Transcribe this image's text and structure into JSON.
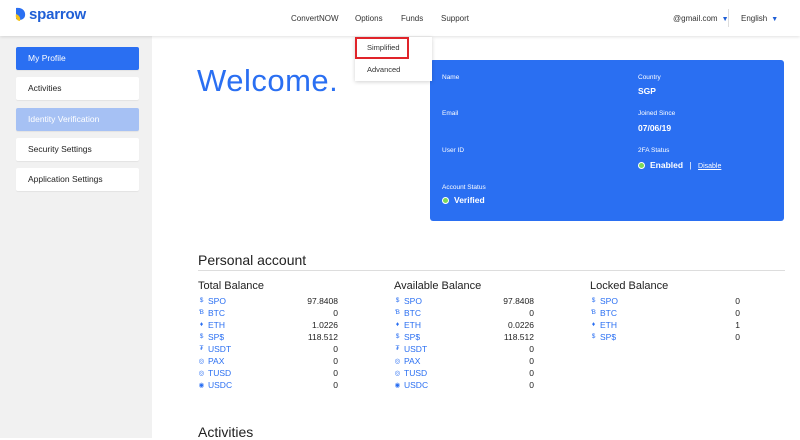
{
  "brand": {
    "name": "sparrow",
    "color": "#1f5fd6"
  },
  "nav": {
    "items": [
      "ConvertNOW",
      "Options",
      "Funds",
      "Support"
    ],
    "account": "@gmail.com",
    "language": "English"
  },
  "dropdown": {
    "items": [
      "Simplified",
      "Advanced"
    ],
    "highlighted": "Simplified"
  },
  "sidebar": {
    "items": [
      "My Profile",
      "Activities",
      "Identity Verification",
      "Security Settings",
      "Application Settings"
    ],
    "active": "My Profile"
  },
  "welcome": "Welcome.",
  "profile": {
    "name_label": "Name",
    "name_value": "",
    "country_label": "Country",
    "country_value": "SGP",
    "email_label": "Email",
    "email_value": "",
    "joined_label": "Joined Since",
    "joined_value": "07/06/19",
    "userid_label": "User ID",
    "userid_value": "",
    "twofa_label": "2FA Status",
    "twofa_value": "Enabled",
    "twofa_separator": "|",
    "twofa_action": "Disable",
    "status_label": "Account Status",
    "status_value": "Verified"
  },
  "personal_account": {
    "title": "Personal account",
    "columns": [
      {
        "title": "Total Balance",
        "rows": [
          {
            "icon": "$",
            "coin": "SPO",
            "amount": "97.8408"
          },
          {
            "icon": "Ɓ",
            "coin": "BTC",
            "amount": "0"
          },
          {
            "icon": "♦",
            "coin": "ETH",
            "amount": "1.0226"
          },
          {
            "icon": "$",
            "coin": "SP$",
            "amount": "118.512"
          },
          {
            "icon": "₮",
            "coin": "USDT",
            "amount": "0"
          },
          {
            "icon": "◎",
            "coin": "PAX",
            "amount": "0"
          },
          {
            "icon": "◎",
            "coin": "TUSD",
            "amount": "0"
          },
          {
            "icon": "◉",
            "coin": "USDC",
            "amount": "0"
          }
        ]
      },
      {
        "title": "Available Balance",
        "rows": [
          {
            "icon": "$",
            "coin": "SPO",
            "amount": "97.8408"
          },
          {
            "icon": "Ɓ",
            "coin": "BTC",
            "amount": "0"
          },
          {
            "icon": "♦",
            "coin": "ETH",
            "amount": "0.0226"
          },
          {
            "icon": "$",
            "coin": "SP$",
            "amount": "118.512"
          },
          {
            "icon": "₮",
            "coin": "USDT",
            "amount": "0"
          },
          {
            "icon": "◎",
            "coin": "PAX",
            "amount": "0"
          },
          {
            "icon": "◎",
            "coin": "TUSD",
            "amount": "0"
          },
          {
            "icon": "◉",
            "coin": "USDC",
            "amount": "0"
          }
        ]
      },
      {
        "title": "Locked Balance",
        "rows": [
          {
            "icon": "$",
            "coin": "SPO",
            "amount": "0"
          },
          {
            "icon": "Ɓ",
            "coin": "BTC",
            "amount": "0"
          },
          {
            "icon": "♦",
            "coin": "ETH",
            "amount": "1"
          },
          {
            "icon": "$",
            "coin": "SP$",
            "amount": "0"
          }
        ]
      }
    ]
  },
  "activities_title": "Activities",
  "colors": {
    "accent": "#2a6ff2",
    "accent_soft": "#a6c1f4",
    "status_green": "#7ed957",
    "highlight_red": "#e0242a"
  }
}
